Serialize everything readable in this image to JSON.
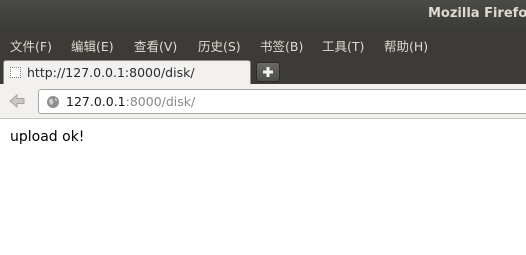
{
  "window": {
    "title": "Mozilla Firefo"
  },
  "menu": {
    "items": [
      {
        "label": "文件(F)"
      },
      {
        "label": "编辑(E)"
      },
      {
        "label": "查看(V)"
      },
      {
        "label": "历史(S)"
      },
      {
        "label": "书签(B)"
      },
      {
        "label": "工具(T)"
      },
      {
        "label": "帮助(H)"
      }
    ]
  },
  "tabs": [
    {
      "title": "http://127.0.0.1:8000/disk/",
      "icon": "blank-page-icon"
    }
  ],
  "toolbar": {
    "new_tab_icon": "plus-icon",
    "back_icon": "back-arrow-icon"
  },
  "urlbar": {
    "domain": "127.0.0.1",
    "rest": ":8000/disk/",
    "icon": "globe-icon"
  },
  "page": {
    "body_text": "upload ok!"
  },
  "colors": {
    "chrome_dark": "#3c3b37",
    "toolbar_light": "#f2f1f0",
    "url_gray": "#8a8a8a"
  }
}
